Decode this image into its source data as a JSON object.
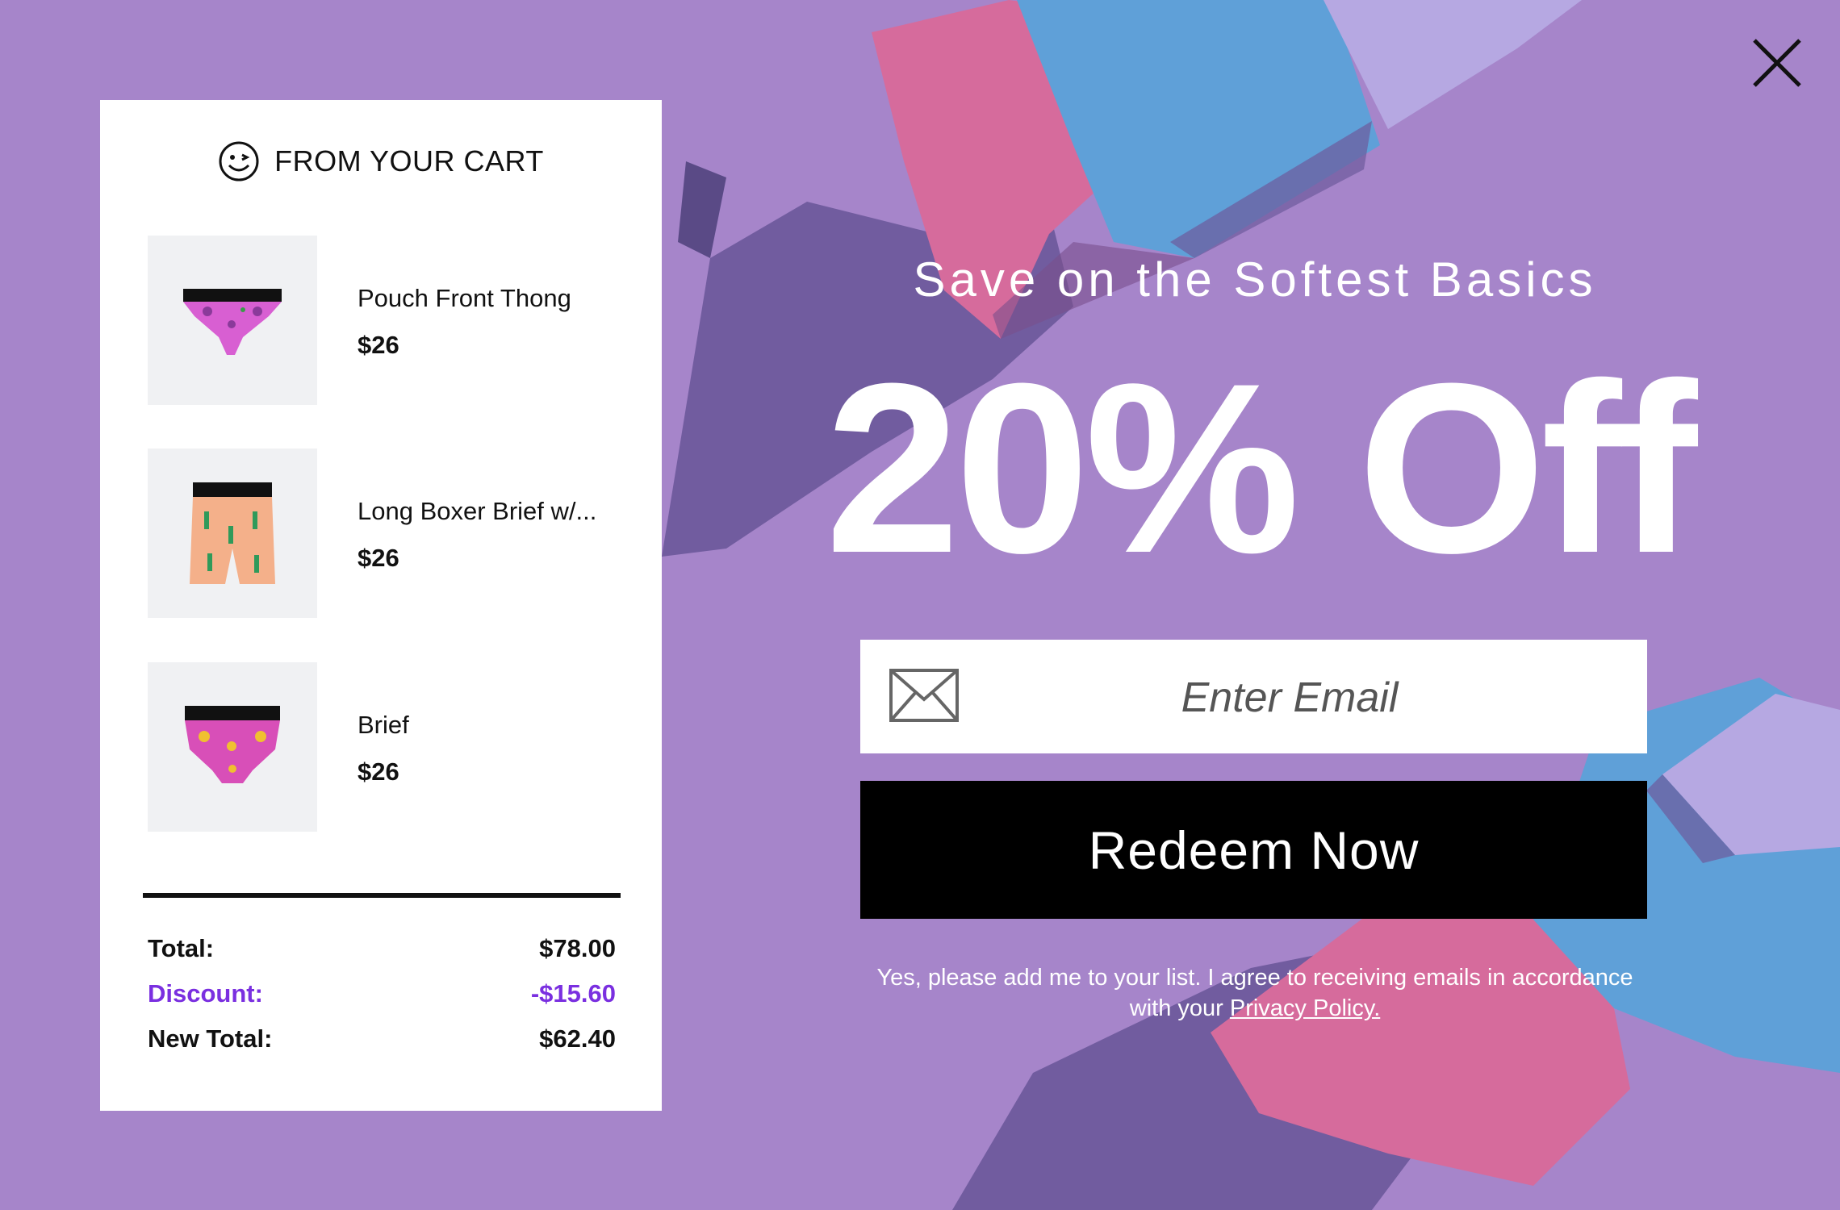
{
  "colors": {
    "background": "#a685ca",
    "panel": "#ffffff",
    "accent_discount": "#7a2fe0",
    "button": "#000000",
    "garment_purple": "#6e5a9c",
    "garment_pink": "#d66b9c",
    "garment_blue": "#5fa0d8",
    "garment_lavender": "#b6a8e2"
  },
  "close": {
    "icon": "close-icon"
  },
  "cart": {
    "icon": "smiley-icon",
    "title": "FROM YOUR CART",
    "items": [
      {
        "name": "Pouch Front Thong",
        "price": "$26",
        "image": "thong-product-image"
      },
      {
        "name": "Long Boxer Brief w/...",
        "price": "$26",
        "image": "boxer-product-image"
      },
      {
        "name": "Brief",
        "price": "$26",
        "image": "brief-product-image"
      }
    ],
    "summary": {
      "total_label": "Total:",
      "total_value": "$78.00",
      "discount_label": "Discount:",
      "discount_value": "-$15.60",
      "new_total_label": "New Total:",
      "new_total_value": "$62.40"
    }
  },
  "promo": {
    "subtitle": "Save on the Softest Basics",
    "headline": "20% Off",
    "email": {
      "icon": "envelope-icon",
      "placeholder": "Enter Email",
      "value": ""
    },
    "button_label": "Redeem Now",
    "consent_text": "Yes, please add me to your list. I agree to receiving emails in accordance with your ",
    "privacy_link": "Privacy Policy."
  }
}
